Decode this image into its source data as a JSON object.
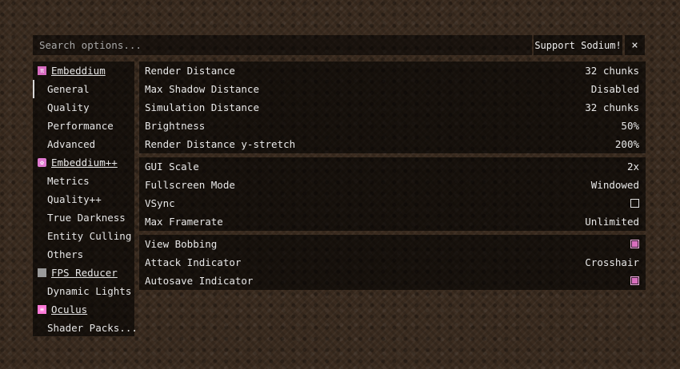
{
  "search": {
    "placeholder": "Search options..."
  },
  "header": {
    "support_label": "Support Sodium!",
    "close_label": "×"
  },
  "colors": {
    "accent": "#d96fbe",
    "panel": "rgba(0,0,0,0.6)"
  },
  "sidebar": {
    "items": [
      {
        "type": "mod",
        "label": "Embeddium",
        "icon": "pi-icon"
      },
      {
        "type": "page",
        "label": "General",
        "active": true
      },
      {
        "type": "page",
        "label": "Quality"
      },
      {
        "type": "page",
        "label": "Performance"
      },
      {
        "type": "page",
        "label": "Advanced"
      },
      {
        "type": "mod",
        "label": "Embeddium++",
        "icon": "gear-icon"
      },
      {
        "type": "page",
        "label": "Metrics"
      },
      {
        "type": "page",
        "label": "Quality++"
      },
      {
        "type": "page",
        "label": "True Darkness"
      },
      {
        "type": "page",
        "label": "Entity Culling"
      },
      {
        "type": "page",
        "label": "Others"
      },
      {
        "type": "mod",
        "label": "FPS Reducer",
        "icon": "fps-reducer-icon"
      },
      {
        "type": "page",
        "label": "Dynamic Lights"
      },
      {
        "type": "mod",
        "label": "Oculus",
        "icon": "oculus-icon"
      },
      {
        "type": "page",
        "label": "Shader Packs..."
      }
    ]
  },
  "options": {
    "groups": [
      {
        "rows": [
          {
            "name": "Render Distance",
            "value": "32 chunks"
          },
          {
            "name": "Max Shadow Distance",
            "value": "Disabled"
          },
          {
            "name": "Simulation Distance",
            "value": "32 chunks"
          },
          {
            "name": "Brightness",
            "value": "50%"
          },
          {
            "name": "Render Distance y-stretch",
            "value": "200%"
          }
        ]
      },
      {
        "rows": [
          {
            "name": "GUI Scale",
            "value": "2x"
          },
          {
            "name": "Fullscreen Mode",
            "value": "Windowed"
          },
          {
            "name": "VSync",
            "checkbox": false
          },
          {
            "name": "Max Framerate",
            "value": "Unlimited"
          }
        ]
      },
      {
        "rows": [
          {
            "name": "View Bobbing",
            "checkbox": true
          },
          {
            "name": "Attack Indicator",
            "value": "Crosshair"
          },
          {
            "name": "Autosave Indicator",
            "checkbox": true
          }
        ]
      }
    ]
  }
}
